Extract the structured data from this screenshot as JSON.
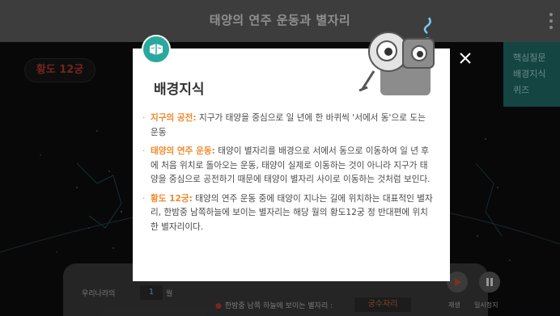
{
  "app": {
    "title": "태양의 연주 운동과 별자리"
  },
  "stage": {
    "zodiac_label": "황도 12궁"
  },
  "side_menu": {
    "items": [
      "핵심질문",
      "배경지식",
      "퀴즈"
    ]
  },
  "bottom_bar": {
    "label_country": "우리나라의",
    "month_value": "1",
    "month_unit": "월",
    "row2_label": "한밤중 남쪽 하늘에 보이는 별자리 :",
    "constellation": "궁수자리",
    "play_label": "재생",
    "pause_label": "일시정지"
  },
  "modal": {
    "title": "배경지식",
    "items": [
      {
        "term": "지구의 공전:",
        "text": " 지구가 태양을 중심으로 일 년에 한 바퀴씩 '서에서 동'으로 도는 운동"
      },
      {
        "term": "태양의 연주 운동:",
        "text": " 태양이 별자리를 배경으로 서에서 동으로 이동하여 일 년 후에 처음 위치로 돌아오는 운동, 태양이 실제로 이동하는 것이 아니라 지구가 태양을 중심으로 공전하기 때문에 태양이 별자리 사이로 이동하는 것처럼 보인다."
      },
      {
        "term": "황도 12궁:",
        "text": " 태양의 연주 운동 중에 태양이 지나는 길에 위치하는 대표적인 별자리, 한밤중 남쪽하늘에 보이는 별자리는 해당 월의 황도12궁 정 반대편에 위치한 별자리이다."
      }
    ]
  },
  "colors": {
    "accent": "#f0892c",
    "teal": "#2ba89e",
    "header": "#5e5e5e"
  },
  "icons": {
    "badge": "book-icon",
    "close": "close-icon",
    "menu": "kebab-menu-icon",
    "play": "play-icon",
    "pause": "pause-icon"
  }
}
